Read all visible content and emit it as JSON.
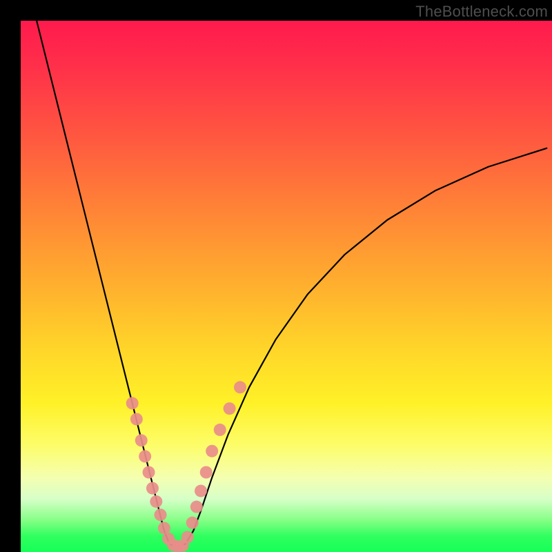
{
  "watermark": "TheBottleneck.com",
  "chart_data": {
    "type": "line",
    "title": "",
    "xlabel": "",
    "ylabel": "",
    "xlim": [
      0,
      100
    ],
    "ylim": [
      0,
      100
    ],
    "series": [
      {
        "name": "left-curve",
        "stroke": "#000000",
        "x": [
          3,
          5,
          7,
          9,
          11,
          13,
          15,
          17,
          19,
          21,
          23,
          24.5,
          26,
          27,
          28
        ],
        "y": [
          100,
          92,
          84,
          76,
          68,
          60,
          52,
          44,
          36,
          28,
          20,
          14,
          8,
          4,
          1.5
        ]
      },
      {
        "name": "right-curve",
        "stroke": "#000000",
        "x": [
          31,
          32.5,
          34,
          36,
          39,
          43,
          48,
          54,
          61,
          69,
          78,
          88,
          99
        ],
        "y": [
          1.5,
          4,
          8,
          14,
          22,
          31,
          40,
          48.5,
          56,
          62.5,
          68,
          72.5,
          76
        ]
      },
      {
        "name": "valley-floor",
        "stroke": "#000000",
        "x": [
          28,
          29.5,
          31
        ],
        "y": [
          1.5,
          1.0,
          1.5
        ]
      }
    ],
    "scatter_points": {
      "name": "markers",
      "color": "#e98d8a",
      "radius_px": 9,
      "points": [
        {
          "x": 21.0,
          "y": 28.0
        },
        {
          "x": 21.8,
          "y": 25.0
        },
        {
          "x": 22.7,
          "y": 21.0
        },
        {
          "x": 23.4,
          "y": 18.0
        },
        {
          "x": 24.1,
          "y": 15.0
        },
        {
          "x": 24.8,
          "y": 12.0
        },
        {
          "x": 25.5,
          "y": 9.5
        },
        {
          "x": 26.3,
          "y": 7.0
        },
        {
          "x": 27.0,
          "y": 4.5
        },
        {
          "x": 27.8,
          "y": 2.5
        },
        {
          "x": 28.7,
          "y": 1.3
        },
        {
          "x": 29.6,
          "y": 1.0
        },
        {
          "x": 30.5,
          "y": 1.2
        },
        {
          "x": 31.4,
          "y": 2.8
        },
        {
          "x": 32.3,
          "y": 5.5
        },
        {
          "x": 33.1,
          "y": 8.5
        },
        {
          "x": 33.9,
          "y": 11.5
        },
        {
          "x": 34.9,
          "y": 15.0
        },
        {
          "x": 36.0,
          "y": 19.0
        },
        {
          "x": 37.5,
          "y": 23.0
        },
        {
          "x": 39.3,
          "y": 27.0
        },
        {
          "x": 41.3,
          "y": 31.0
        }
      ]
    },
    "gradient_stops": [
      {
        "pos": 0,
        "color": "#ff1a4d"
      },
      {
        "pos": 8,
        "color": "#ff2e4a"
      },
      {
        "pos": 22,
        "color": "#ff5840"
      },
      {
        "pos": 36,
        "color": "#ff8536"
      },
      {
        "pos": 50,
        "color": "#ffb02e"
      },
      {
        "pos": 62,
        "color": "#ffd629"
      },
      {
        "pos": 72,
        "color": "#fff128"
      },
      {
        "pos": 80,
        "color": "#fdfd6a"
      },
      {
        "pos": 86,
        "color": "#f4ffb0"
      },
      {
        "pos": 90,
        "color": "#d7ffc8"
      },
      {
        "pos": 94,
        "color": "#86ff86"
      },
      {
        "pos": 97,
        "color": "#30ff5f"
      },
      {
        "pos": 100,
        "color": "#16ff58"
      }
    ]
  }
}
